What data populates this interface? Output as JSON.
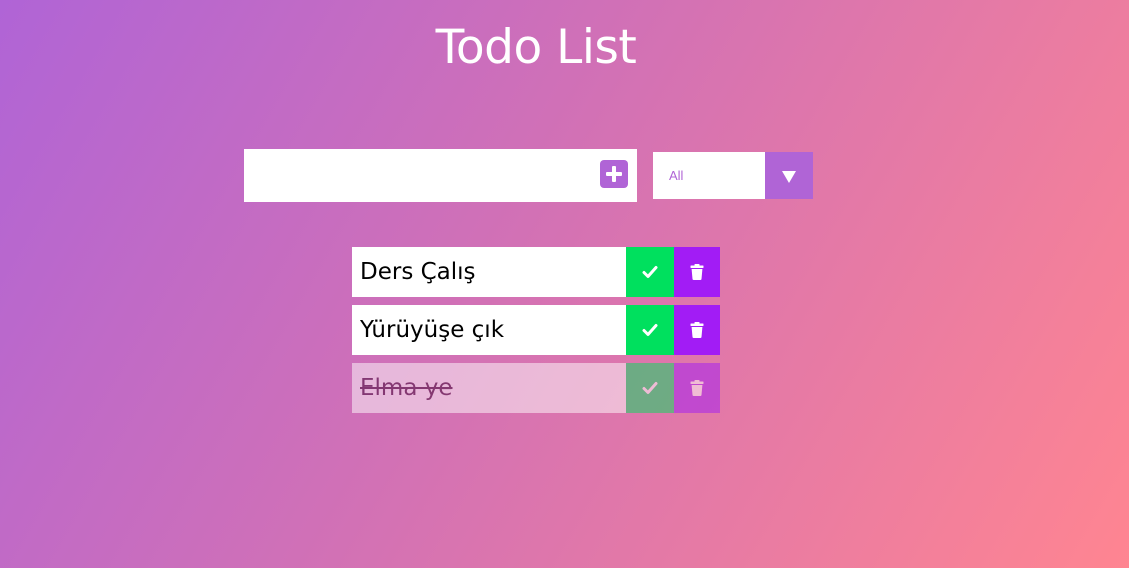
{
  "header": {
    "title": "Todo List"
  },
  "input": {
    "value": "",
    "placeholder": ""
  },
  "filter": {
    "selected": "All"
  },
  "todos": [
    {
      "text": "Ders Çalış",
      "completed": false
    },
    {
      "text": "Yürüyüşe çık",
      "completed": false
    },
    {
      "text": "Elma ye",
      "completed": true
    }
  ],
  "icons": {
    "add": "plus-square-icon",
    "dropdown": "triangle-down-icon",
    "check": "check-icon",
    "trash": "trash-icon"
  },
  "colors": {
    "accent": "#b064d6",
    "complete_button": "#00e05e",
    "trash_button": "#a21cf5",
    "gradient_start": "#b064d6",
    "gradient_end": "#ff8591"
  }
}
